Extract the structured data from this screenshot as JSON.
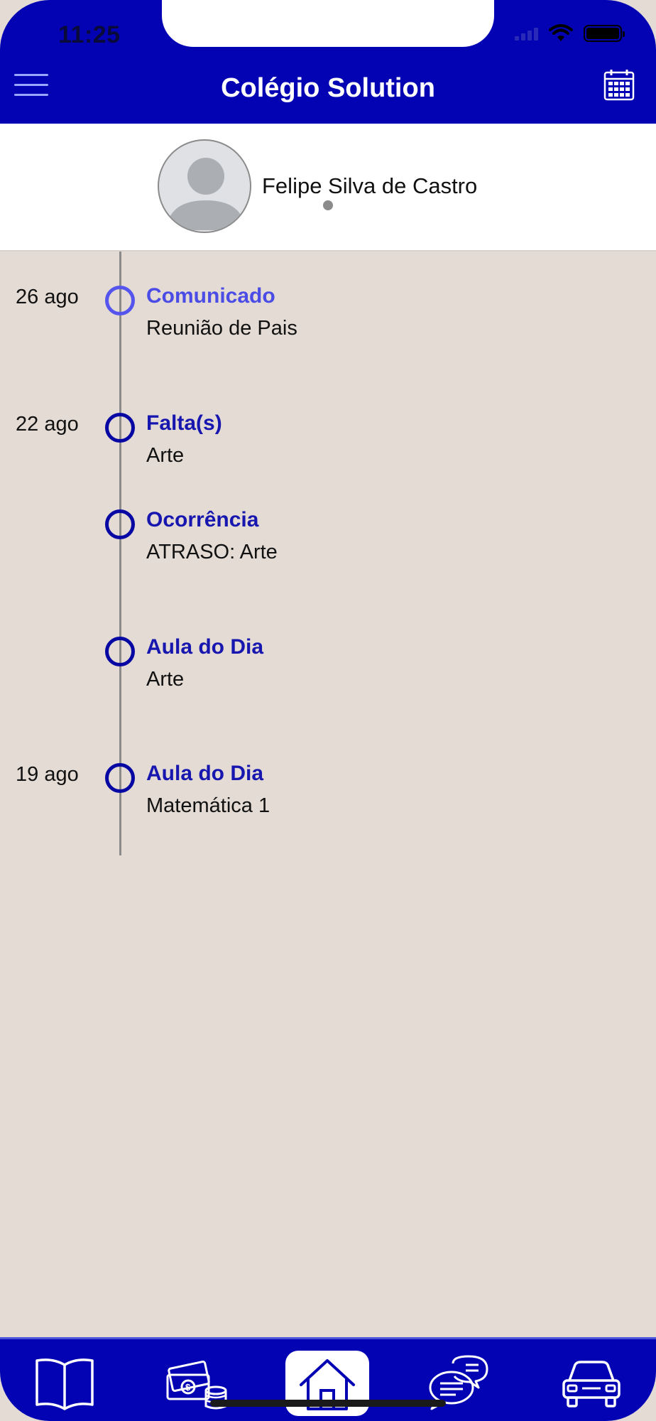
{
  "status_bar": {
    "time": "11:25"
  },
  "header": {
    "title": "Colégio Solution"
  },
  "profile": {
    "student_name": "Felipe Silva de Castro"
  },
  "timeline": [
    {
      "date": "26 ago",
      "title": "Comunicado",
      "subtitle": "Reunião de Pais"
    },
    {
      "date": "22 ago",
      "title": "Falta(s)",
      "subtitle": "Arte"
    },
    {
      "date": "",
      "title": "Ocorrência",
      "subtitle": "ATRASO: Arte"
    },
    {
      "date": "",
      "title": "Aula do Dia",
      "subtitle": "Arte"
    },
    {
      "date": "19 ago",
      "title": "Aula do Dia",
      "subtitle": "Matemática 1"
    }
  ],
  "bottom_nav": [
    {
      "icon": "book-icon"
    },
    {
      "icon": "money-icon"
    },
    {
      "icon": "home-icon",
      "active": true
    },
    {
      "icon": "chat-icon"
    },
    {
      "icon": "car-icon"
    }
  ],
  "colors": {
    "primary": "#0303b3",
    "accent": "#4b4be6",
    "background": "#e3dbd4"
  }
}
